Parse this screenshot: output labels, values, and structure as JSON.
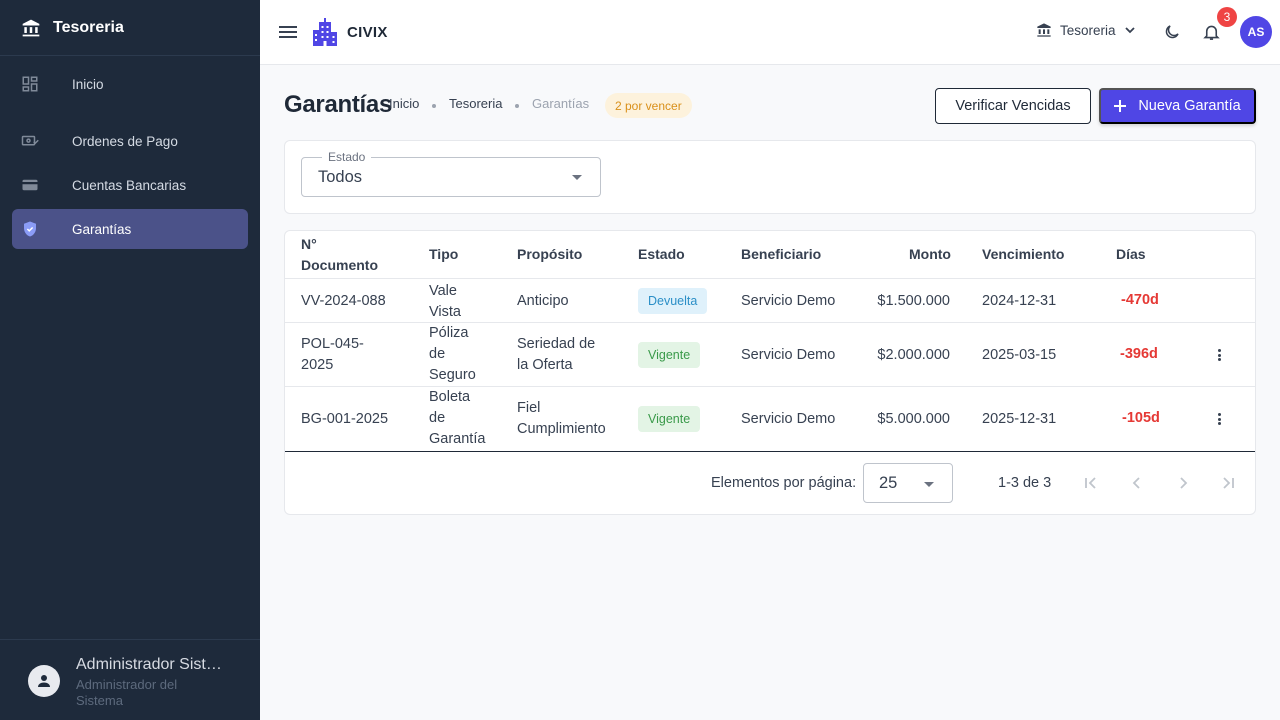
{
  "sidebar": {
    "brand": "Tesoreria",
    "items": [
      {
        "label": "Inicio",
        "icon": "dashboard-icon"
      },
      {
        "label": "Ordenes de Pago",
        "icon": "payment-icon"
      },
      {
        "label": "Cuentas Bancarias",
        "icon": "credit-card-icon"
      },
      {
        "label": "Garantías",
        "icon": "shield-check-icon",
        "active": true
      }
    ],
    "user": {
      "name": "Administrador Sist…",
      "role": "Administrador del Sistema"
    }
  },
  "topbar": {
    "app_name": "CIVIX",
    "org": "Tesoreria",
    "notifications": "3",
    "avatar_initials": "AS"
  },
  "header": {
    "title": "Garantías",
    "breadcrumb": [
      "Inicio",
      "Tesoreria",
      "Garantías"
    ],
    "warning_chip": "2 por vencer",
    "verify_button": "Verificar Vencidas",
    "new_button": "Nueva Garantía"
  },
  "filter": {
    "label": "Estado",
    "value": "Todos"
  },
  "table": {
    "headers": [
      "N° Documento",
      "Tipo",
      "Propósito",
      "Estado",
      "Beneficiario",
      "Monto",
      "Vencimiento",
      "Días"
    ],
    "rows": [
      {
        "doc": "VV-2024-088",
        "tipo": "Vale Vista",
        "proposito": "Anticipo",
        "estado": "Devuelta",
        "beneficiario": "Servicio Demo",
        "monto": "$1.500.000",
        "vencimiento": "2024-12-31",
        "dias": "-470d"
      },
      {
        "doc": "POL-045-2025",
        "tipo": "Póliza de Seguro",
        "proposito": "Seriedad de la Oferta",
        "estado": "Vigente",
        "beneficiario": "Servicio Demo",
        "monto": "$2.000.000",
        "vencimiento": "2025-03-15",
        "dias": "-396d"
      },
      {
        "doc": "BG-001-2025",
        "tipo": "Boleta de Garantía",
        "proposito": "Fiel Cumplimiento",
        "estado": "Vigente",
        "beneficiario": "Servicio Demo",
        "monto": "$5.000.000",
        "vencimiento": "2025-12-31",
        "dias": "-105d"
      }
    ]
  },
  "paginator": {
    "label": "Elementos por página:",
    "page_size": "25",
    "range": "1-3 de 3"
  },
  "colors": {
    "sidebar_bg": "#1e2a3b",
    "sidebar_active": "#4b5289",
    "primary": "#4f46e5",
    "danger": "#e53935",
    "warning_text": "#d9901a"
  }
}
